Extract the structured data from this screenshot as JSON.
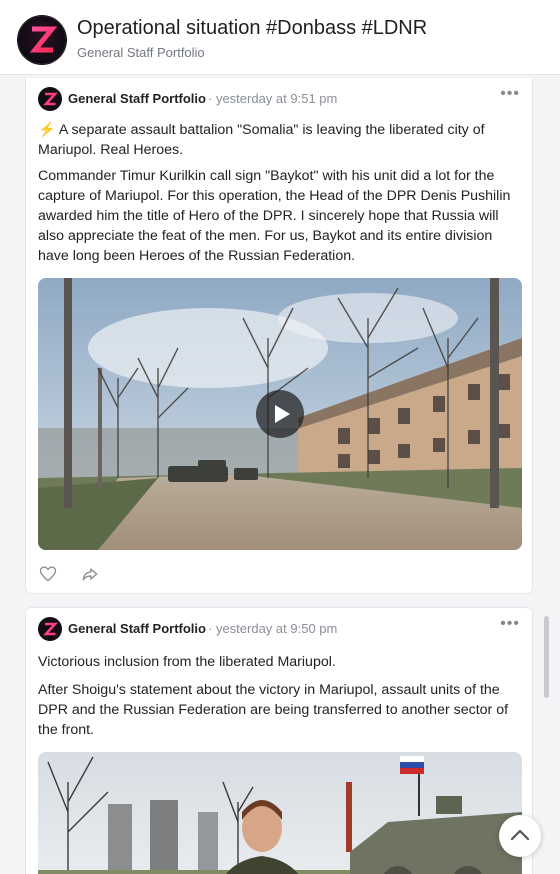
{
  "channel": {
    "title": "Operational situation #Donbass #LDNR",
    "subtitle": "General Staff Portfolio",
    "avatar_letter": "Z"
  },
  "posts": [
    {
      "author": "General Staff Portfolio",
      "time": "· yesterday at 9:51 pm",
      "paragraphs": [
        "A separate assault battalion \"Somalia\" is leaving the liberated city of Mariupol. Real Heroes.",
        "Commander Timur Kurilkin call sign \"Baykot\" with his unit did a lot for the capture of Mariupol. For this operation, the Head of the DPR Denis Pushilin awarded him the title of Hero of the DPR. I sincerely hope that Russia will also appreciate the feat of the men. For us, Baykot and its entire division have long been Heroes of the Russian Federation."
      ],
      "lead_emoji": "⚡",
      "media": "video"
    },
    {
      "author": "General Staff Portfolio",
      "time": "· yesterday at 9:50 pm",
      "paragraphs": [
        "Victorious inclusion from the liberated Mariupol.",
        "After Shoigu's statement about the victory in Mariupol, assault units of the DPR and the Russian Federation are being transferred to another sector of the front."
      ],
      "media": "video"
    }
  ],
  "icons": {
    "like": "heart-icon",
    "share": "share-icon",
    "more": "more-dots-icon",
    "play": "play-icon",
    "scroll_top": "chevron-up-icon"
  },
  "colors": {
    "accent": "#e8336d",
    "bolt": "#f5b800"
  }
}
